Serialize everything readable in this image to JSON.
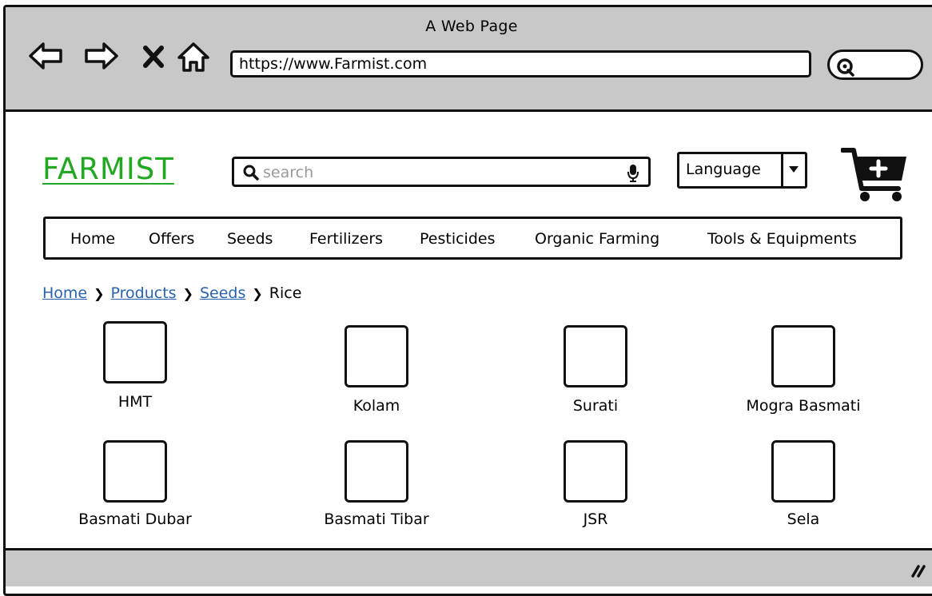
{
  "window": {
    "title": "A Web Page"
  },
  "browser": {
    "url": "https://www.Farmist.com",
    "icons": [
      "back-arrow-icon",
      "forward-arrow-icon",
      "close-icon",
      "home-icon",
      "search-icon"
    ]
  },
  "header": {
    "logo": "FARMIST",
    "search": {
      "placeholder": "search",
      "value": ""
    },
    "language": {
      "label": "Language"
    },
    "logo_color": "#22a822"
  },
  "nav": {
    "items": [
      "Home",
      "Offers",
      "Seeds",
      "Fertilizers",
      "Pesticides",
      "Organic Farming",
      "Tools & Equipments"
    ]
  },
  "breadcrumb": {
    "links": [
      "Home",
      "Products",
      "Seeds"
    ],
    "current": "Rice",
    "link_color": "#2a62b0"
  },
  "products": [
    {
      "name": "HMT"
    },
    {
      "name": "Kolam"
    },
    {
      "name": "Surati"
    },
    {
      "name": "Mogra Basmati"
    },
    {
      "name": "Basmati Dubar"
    },
    {
      "name": "Basmati Tibar"
    },
    {
      "name": "JSR"
    },
    {
      "name": "Sela"
    }
  ]
}
